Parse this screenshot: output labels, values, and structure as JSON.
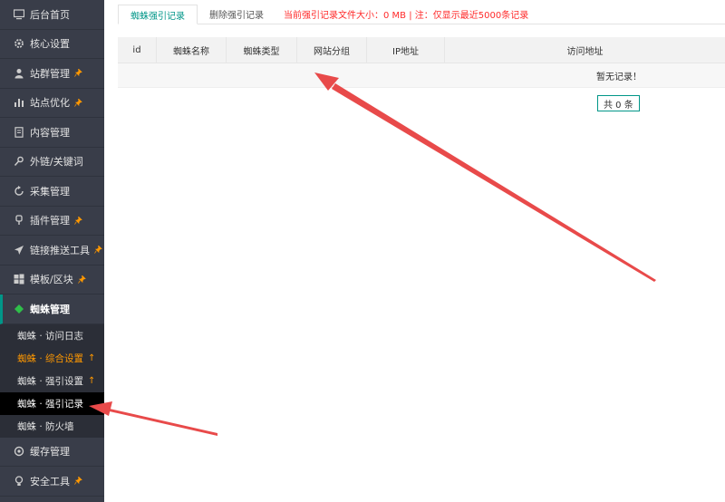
{
  "sidebar": {
    "items": [
      {
        "label": "后台首页",
        "icon": "monitor-icon",
        "pinned": false
      },
      {
        "label": "核心设置",
        "icon": "gear-icon",
        "pinned": false
      },
      {
        "label": "站群管理",
        "icon": "user-icon",
        "pinned": true
      },
      {
        "label": "站点优化",
        "icon": "bar-chart-icon",
        "pinned": true
      },
      {
        "label": "内容管理",
        "icon": "document-icon",
        "pinned": false
      },
      {
        "label": "外链/关键词",
        "icon": "key-icon",
        "pinned": false
      },
      {
        "label": "采集管理",
        "icon": "refresh-icon",
        "pinned": false
      },
      {
        "label": "插件管理",
        "icon": "plugin-icon",
        "pinned": true
      },
      {
        "label": "链接推送工具",
        "icon": "send-icon",
        "pinned": true
      },
      {
        "label": "模板/区块",
        "icon": "windows-icon",
        "pinned": true
      },
      {
        "label": "蜘蛛管理",
        "icon": "spider-icon",
        "pinned": false,
        "active": true
      }
    ],
    "sub_items": [
      {
        "label": "蜘蛛 · 访问日志",
        "style": "normal"
      },
      {
        "label": "蜘蛛 · 综合设置",
        "style": "orange",
        "suffix": "↑"
      },
      {
        "label": "蜘蛛 · 强引设置",
        "style": "normal",
        "suffix": "↑"
      },
      {
        "label": "蜘蛛 · 强引记录",
        "style": "current"
      },
      {
        "label": "蜘蛛 · 防火墙",
        "style": "normal"
      }
    ],
    "bottom_items": [
      {
        "label": "缓存管理",
        "icon": "cache-icon",
        "pinned": false
      },
      {
        "label": "安全工具",
        "icon": "bulb-icon",
        "pinned": true
      }
    ]
  },
  "tabs": {
    "active": "蜘蛛强引记录",
    "other": "删除强引记录",
    "note": "当前强引记录文件大小：0 MB | 注：仅显示最近5000条记录"
  },
  "table": {
    "columns": [
      "id",
      "蜘蛛名称",
      "蜘蛛类型",
      "网站分组",
      "IP地址",
      "访问地址"
    ],
    "empty_text": "暂无记录！"
  },
  "pager": {
    "text": "共 0 条"
  },
  "colors": {
    "sidebar_bg": "#393d49",
    "accent": "#009688",
    "warning": "#ff2a2a",
    "orange": "#ff9800",
    "arrow": "#e84a4a"
  }
}
